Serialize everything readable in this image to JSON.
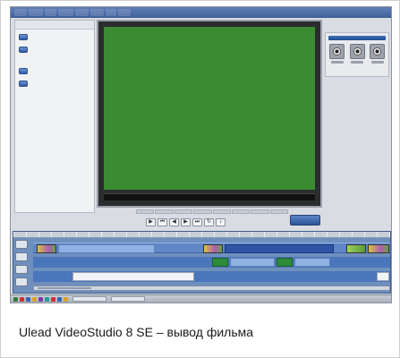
{
  "caption": "Ulead VideoStudio 8 SE – вывод фильма",
  "app": {
    "preview_color": "#3b8b33",
    "accent": "#2f56a6"
  }
}
